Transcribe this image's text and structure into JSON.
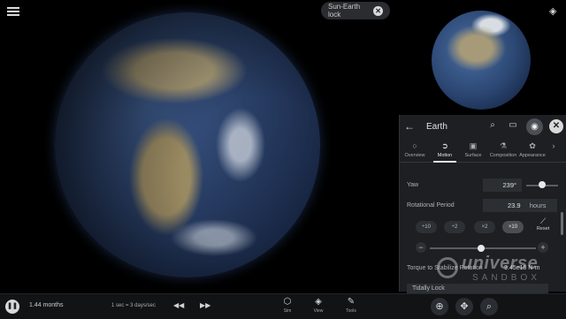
{
  "top": {
    "search_label": "Sun-Earth lock",
    "clear_symbol": "✕"
  },
  "panel": {
    "title": "Earth",
    "back_symbol": "←",
    "close_symbol": "✕",
    "tabs": [
      {
        "label": "Overview",
        "icon": "circle-icon"
      },
      {
        "label": "Motion",
        "icon": "motion-icon"
      },
      {
        "label": "Surface",
        "icon": "image-icon"
      },
      {
        "label": "Composition",
        "icon": "flask-icon"
      },
      {
        "label": "Appearance",
        "icon": "palette-icon"
      }
    ],
    "active_tab": "Motion",
    "yaw": {
      "label": "Yaw",
      "value": "239°",
      "slider_fraction": 0.72
    },
    "rotational_period": {
      "label": "Rotational Period",
      "value": "23.9",
      "unit": "hours",
      "chips": [
        "÷10",
        "÷2",
        "×2",
        "×10"
      ],
      "selected_chip": "×10",
      "reset_label": "Reset",
      "slider_fraction": 0.5
    },
    "torque": {
      "label": "Torque to Stabilize Rotation",
      "value": "9.45e18 N·m"
    },
    "lock_label": "Tidally Lock"
  },
  "watermark": {
    "line1": "universe",
    "line2": "SANDBOX"
  },
  "bottom": {
    "time": "1.44 months",
    "speed": "1 sec = 3 days/sec",
    "rewind_symbol": "◀◀",
    "forward_symbol": "▶▶",
    "tools": [
      {
        "label": "Sim",
        "icon": "cube-icon"
      },
      {
        "label": "View",
        "icon": "layers-icon"
      },
      {
        "label": "Tools",
        "icon": "wrench-icon"
      }
    ]
  }
}
